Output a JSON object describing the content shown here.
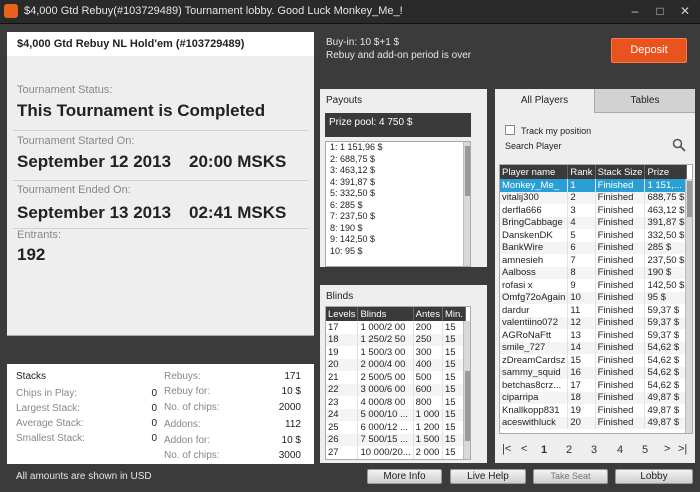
{
  "window": {
    "title": "$4,000 Gtd Rebuy(#103729489) Tournament lobby. Good Luck Monkey_Me_!",
    "controls": [
      "–",
      "□",
      "✕"
    ]
  },
  "tournament": {
    "name": "$4,000 Gtd Rebuy NL Hold'em (#103729489)",
    "status_label": "Tournament Status:",
    "status_value": "This Tournament is Completed",
    "started_label": "Tournament Started On:",
    "started_value": "September 12 2013",
    "started_time": "20:00 MSKS",
    "ended_label": "Tournament Ended On:",
    "ended_value": "September 13 2013",
    "ended_time": "02:41 MSKS",
    "entrants_label": "Entrants:",
    "entrants_value": "192"
  },
  "buyin": {
    "line1": "Buy-in: 10 $+1 $",
    "line2": "Rebuy and add-on period is over",
    "deposit_label": "Deposit"
  },
  "payouts": {
    "title": "Payouts",
    "prize_pool": "Prize pool: 4 750 $",
    "rows": [
      "1: 1 151,96 $",
      "2: 688,75 $",
      "3: 463,12 $",
      "4: 391,87 $",
      "5: 332,50 $",
      "6: 285 $",
      "7: 237,50 $",
      "8: 190 $",
      "9: 142,50 $",
      "10: 95 $"
    ]
  },
  "blinds": {
    "title": "Blinds",
    "headers": [
      "Levels",
      "Blinds",
      "Antes",
      "Min."
    ],
    "rows": [
      [
        "17",
        "1 000/2 00",
        "200",
        "15"
      ],
      [
        "18",
        "1 250/2 50",
        "250",
        "15"
      ],
      [
        "19",
        "1 500/3 00",
        "300",
        "15"
      ],
      [
        "20",
        "2 000/4 00",
        "400",
        "15"
      ],
      [
        "21",
        "2 500/5 00",
        "500",
        "15"
      ],
      [
        "22",
        "3 000/6 00",
        "600",
        "15"
      ],
      [
        "23",
        "4 000/8 00",
        "800",
        "15"
      ],
      [
        "24",
        "5 000/10 ...",
        "1 000",
        "15"
      ],
      [
        "25",
        "6 000/12 ...",
        "1 200",
        "15"
      ],
      [
        "26",
        "7 500/15 ...",
        "1 500",
        "15"
      ],
      [
        "27",
        "10 000/20...",
        "2 000",
        "15"
      ]
    ]
  },
  "players": {
    "tab_all": "All Players",
    "tab_tables": "Tables",
    "track_label": "Track my position",
    "search_placeholder": "Search Player",
    "headers": [
      "Player name",
      "Rank",
      "Stack Size",
      "Prize"
    ],
    "rows": [
      [
        "Monkey_Me_",
        "1",
        "Finished",
        "1 151,..."
      ],
      [
        "vitalij300",
        "2",
        "Finished",
        "688,75 $"
      ],
      [
        "derfla666",
        "3",
        "Finished",
        "463,12 $"
      ],
      [
        "BringCabbage",
        "4",
        "Finished",
        "391,87 $"
      ],
      [
        "DanskenDK",
        "5",
        "Finished",
        "332,50 $"
      ],
      [
        "BankWire",
        "6",
        "Finished",
        "285 $"
      ],
      [
        "amnesieh",
        "7",
        "Finished",
        "237,50 $"
      ],
      [
        "Aalboss",
        "8",
        "Finished",
        "190 $"
      ],
      [
        "rofasi x",
        "9",
        "Finished",
        "142,50 $"
      ],
      [
        "Omfg72oAgain",
        "10",
        "Finished",
        "95 $"
      ],
      [
        "dardur",
        "11",
        "Finished",
        "59,37 $"
      ],
      [
        "valentiino072",
        "12",
        "Finished",
        "59,37 $"
      ],
      [
        "AGRoNaFtt",
        "13",
        "Finished",
        "59,37 $"
      ],
      [
        "smile_727",
        "14",
        "Finished",
        "54,62 $"
      ],
      [
        "zDreamCardsz",
        "15",
        "Finished",
        "54,62 $"
      ],
      [
        "sammy_squid",
        "16",
        "Finished",
        "54,62 $"
      ],
      [
        "betchas8crz...",
        "17",
        "Finished",
        "54,62 $"
      ],
      [
        "ciparripa",
        "18",
        "Finished",
        "49,87 $"
      ],
      [
        "Knallkopp831",
        "19",
        "Finished",
        "49,87 $"
      ],
      [
        "aceswithluck",
        "20",
        "Finished",
        "49,87 $"
      ]
    ],
    "pager": [
      "|<",
      "<",
      "1",
      "2",
      "3",
      "4",
      "5",
      ">",
      ">|"
    ]
  },
  "stacks": {
    "title": "Stacks",
    "chips_in_play_label": "Chips in Play:",
    "chips_in_play_value": "0",
    "largest_label": "Largest Stack:",
    "largest_value": "0",
    "average_label": "Average Stack:",
    "average_value": "0",
    "smallest_label": "Smallest Stack:",
    "smallest_value": "0",
    "rebuys_label": "Rebuys:",
    "rebuys_value": "171",
    "rebuy_for_label": "Rebuy for:",
    "rebuy_for_value": "10 $",
    "rebuy_chips_label": "No. of chips:",
    "rebuy_chips_value": "2000",
    "addons_label": "Addons:",
    "addons_value": "112",
    "addon_for_label": "Addon for:",
    "addon_for_value": "10 $",
    "addon_chips_label": "No. of chips:",
    "addon_chips_value": "3000"
  },
  "footer": {
    "note": "All amounts are shown in USD",
    "more_info": "More Info",
    "live_help": "Live Help",
    "take_seat": "Take Seat",
    "lobby": "Lobby"
  }
}
